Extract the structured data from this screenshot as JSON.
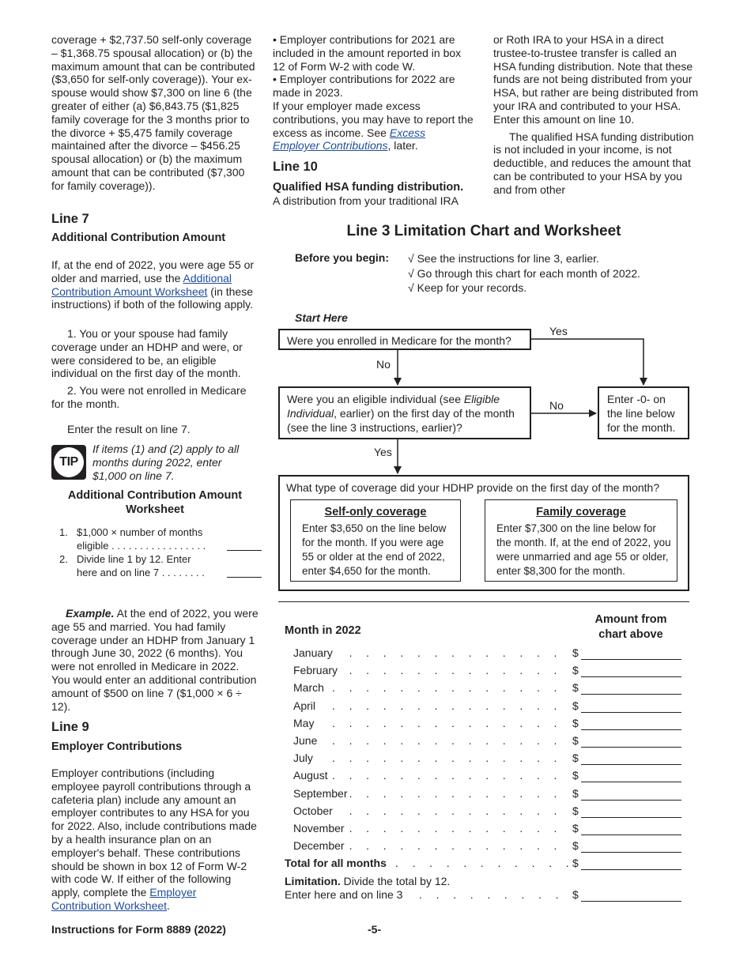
{
  "left_column": {
    "intro_para": "coverage + $2,737.50 self-only coverage – $1,368.75 spousal allocation) or (b) the maximum amount that can be contributed ($3,650 for self-only coverage)). Your ex-spouse would show $7,300 on line 6 (the greater of either (a) $6,843.75 ($1,825 family coverage for the 3 months prior to the divorce + $5,475 family coverage maintained after the divorce – $456.25 spousal allocation) or (b) the maximum amount that can be contributed ($7,300 for family coverage)).",
    "line7_heading": "Line 7",
    "line7_subheading": "Additional Contribution Amount",
    "line7_para_pre": "If, at the end of 2022, you were age 55 or older and married, use the ",
    "line7_link": "Additional Contribution Amount Worksheet",
    "line7_para_post": " (in these instructions) if both of the following apply.",
    "item1": "1.  You or your spouse had family coverage under an HDHP and were, or were considered to be, an eligible individual on the first day of the month.",
    "item2": "2.  You were not enrolled in Medicare for the month.",
    "enter_result": "Enter the result on line 7.",
    "tip_label": "TIP",
    "tip_text": "If items (1) and (2) apply to all months during 2022, enter $1,000 on line 7.",
    "worksheet_title": "Additional Contribution Amount Worksheet",
    "worksheet_rows": [
      {
        "num": "1.",
        "line1": "$1,000 × number of months",
        "line2": "eligible  . . . . . . . . . . . . . . . . ."
      },
      {
        "num": "2.",
        "line1": "Divide line 1 by 12. Enter",
        "line2": "here and on line 7   . . . . . . . ."
      }
    ],
    "example_label": "Example.",
    "example_text": " At the end of 2022, you were age 55 and married. You had family coverage under an HDHP from January 1 through June 30, 2022 (6 months). You were not enrolled in Medicare in 2022. You would enter an additional contribution amount of $500 on line 7 ($1,000 × 6 ÷ 12).",
    "line9_heading": "Line 9",
    "line9_subheading": "Employer Contributions",
    "line9_para_pre": "Employer contributions (including employee payroll contributions through a cafeteria plan) include any amount an employer contributes to any HSA for you for 2022. Also, include contributions made by a health insurance plan on an employer's behalf. These contributions should be shown in box 12 of Form W-2 with code W. If either of the following apply, complete the ",
    "line9_link": "Employer Contribution Worksheet",
    "line9_para_post": "."
  },
  "middle_column": {
    "bullet1": "•  Employer contributions for 2021 are included in the amount reported in box 12 of Form W-2 with code W.",
    "bullet2": "•  Employer contributions for 2022 are made in 2023.",
    "excess_pre": "If your employer made excess contributions, you may have to report the excess as income. See ",
    "excess_link": "Excess Employer Contributions",
    "excess_post": ", later.",
    "line10_heading": "Line 10",
    "line10_bold": "Qualified HSA funding distribution.",
    "line10_text": "A distribution from your traditional IRA"
  },
  "right_column": {
    "para1": "or Roth IRA to your HSA in a direct trustee-to-trustee transfer is called an HSA funding distribution. Note that these funds are not being distributed from your HSA, but rather are being distributed from your IRA and contributed to your HSA. Enter this amount on line 10.",
    "para2": "The qualified HSA funding distribution is not included in your income, is not deductible, and reduces the amount that can be contributed to your HSA by you and from other"
  },
  "chart": {
    "title": "Line 3 Limitation Chart and Worksheet",
    "before_label": "Before you begin:",
    "before_items": [
      "√ See the instructions for line 3, earlier.",
      "√ Go through this chart for each month of 2022.",
      "√ Keep for your records."
    ],
    "start_here": "Start Here",
    "q1": "Were you enrolled in Medicare for the month?",
    "q1_yes": "Yes",
    "q1_no": "No",
    "q2_pre": "Were you an eligible individual (see ",
    "q2_italic1": "Eligible",
    "q2_italic2": "Individual",
    "q2_mid": ", earlier) on the first day of the month",
    "q2_post": "(see the line 3 instructions, earlier)?",
    "q2_no": "No",
    "q2_yes": "Yes",
    "zero_box": "Enter -0- on the line below for the month.",
    "q3": "What type of coverage did your HDHP provide on the first day of the month?",
    "self_only_title": "Self-only coverage",
    "self_only_text": "Enter $3,650 on the line below for the month. If you were age 55 or older at the end of 2022, enter $4,650 for the month.",
    "family_title": "Family coverage",
    "family_text": "Enter $7,300 on the line below for the month. If, at the end of 2022, you were unmarried and age 55 or older, enter $8,300 for the month."
  },
  "worksheet": {
    "month_header": "Month in 2022",
    "amount_header": "Amount from chart above",
    "months": [
      "January",
      "February",
      "March",
      "April",
      "May",
      "June",
      "July",
      "August",
      "September",
      "October",
      "November",
      "December"
    ],
    "dots": ". . . . . . . . . . . . . . . . . . . . . . . .",
    "dollar": "$",
    "total_label": "Total for all months",
    "limitation_bold": "Limitation.",
    "limitation_text": " Divide the total by 12.",
    "limitation_line2": "Enter here and on line 3"
  },
  "footer": {
    "form_title": "Instructions for Form 8889 (2022)",
    "page_number": "-5-"
  }
}
